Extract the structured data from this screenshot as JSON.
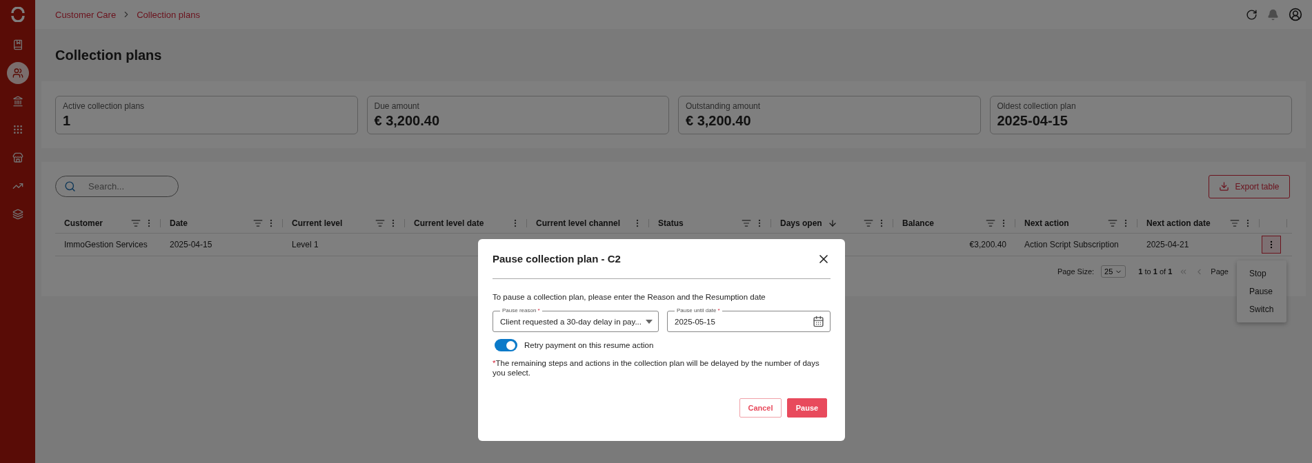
{
  "breadcrumb": [
    "Customer Care",
    "Collection plans"
  ],
  "sidebar": {
    "items": [
      {
        "selected": false
      },
      {
        "selected": true
      },
      {
        "selected": false
      },
      {
        "selected": false
      },
      {
        "selected": false
      },
      {
        "selected": false
      },
      {
        "selected": false
      }
    ]
  },
  "page_title": "Collection plans",
  "stats": [
    {
      "label": "Active collection plans",
      "value": "1"
    },
    {
      "label": "Due amount",
      "value": "€ 3,200.40"
    },
    {
      "label": "Outstanding amount",
      "value": "€ 3,200.40"
    },
    {
      "label": "Oldest collection plan",
      "value": "2025-04-15"
    }
  ],
  "search": {
    "placeholder": "Search..."
  },
  "export_button": "Export table",
  "table": {
    "columns": [
      {
        "label": "Customer",
        "filterable": true,
        "sorted": false,
        "kind": "text"
      },
      {
        "label": "Date",
        "filterable": true,
        "sorted": false,
        "kind": "text"
      },
      {
        "label": "Current level",
        "filterable": true,
        "sorted": false,
        "kind": "text"
      },
      {
        "label": "Current level date",
        "filterable": false,
        "sorted": false,
        "kind": "text"
      },
      {
        "label": "Current level channel",
        "filterable": false,
        "sorted": false,
        "kind": "text"
      },
      {
        "label": "Status",
        "filterable": true,
        "sorted": false,
        "kind": "text"
      },
      {
        "label": "Days open",
        "filterable": true,
        "sorted": true,
        "kind": "text"
      },
      {
        "label": "Balance",
        "filterable": true,
        "sorted": false,
        "kind": "amount"
      },
      {
        "label": "Next action",
        "filterable": true,
        "sorted": false,
        "kind": "text"
      },
      {
        "label": "Next action date",
        "filterable": true,
        "sorted": false,
        "kind": "text"
      }
    ],
    "rows": [
      {
        "cells": [
          "ImmoGestion Services",
          "2025-04-15",
          "Level 1",
          null,
          null,
          null,
          null,
          "€3,200.40",
          "Action Script Subscription",
          "2025-04-21"
        ],
        "actions_selected": true
      }
    ]
  },
  "pagination": {
    "page_size_label": "Page Size:",
    "page_size": "25",
    "range": "**1** to **1** of **1**",
    "page_label": "Page"
  },
  "row_menu": [
    "Stop",
    "Pause",
    "Switch"
  ],
  "dialog": {
    "title": "Pause collection plan - C2",
    "description": "To pause a collection plan, please enter the Reason and the Resumption date",
    "reason": {
      "label": "Pause reason",
      "required_mark": "*",
      "value": "Client requested a 30-day delay in pay..."
    },
    "date": {
      "label": "Pause until date",
      "required_mark": "*",
      "value": "2025-05-15"
    },
    "toggle": {
      "label": "Retry payment on this resume action",
      "on": true
    },
    "note": {
      "mark": "*",
      "text": "The remaining steps and actions in the collection plan will be delayed by the number of days you select."
    },
    "buttons": {
      "cancel": "Cancel",
      "confirm": "Pause"
    }
  }
}
